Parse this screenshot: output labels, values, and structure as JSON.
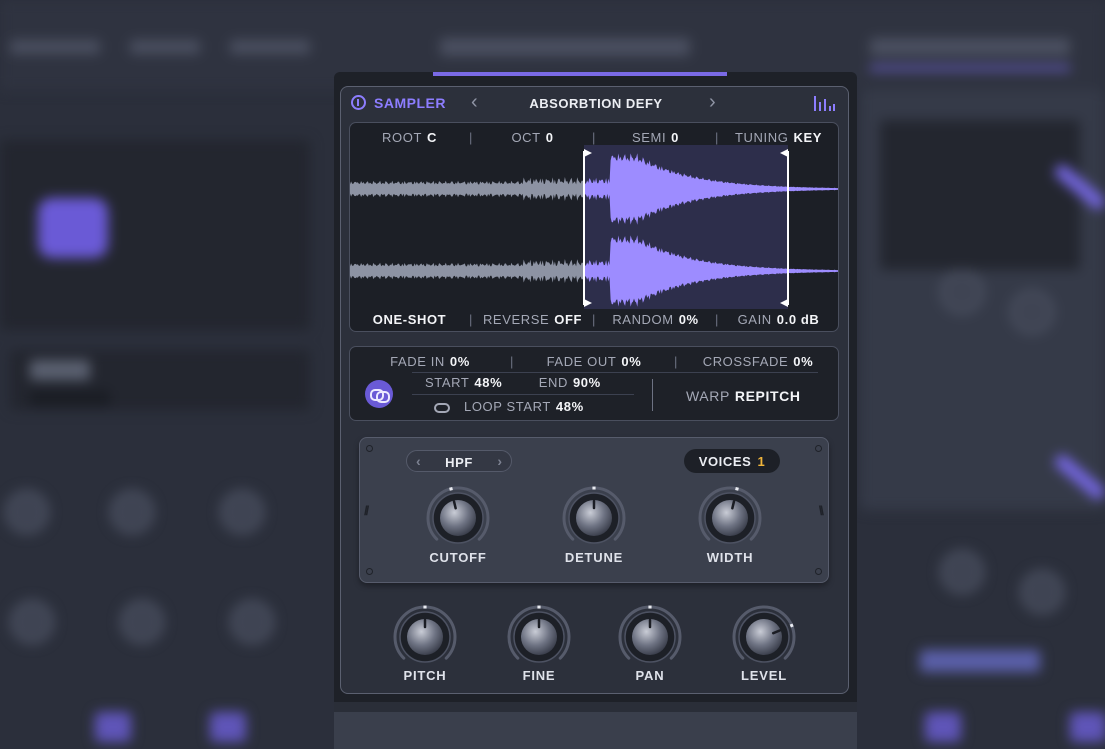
{
  "plugin": {
    "title": "SAMPLER",
    "preset": "ABSORBTION DEFY",
    "prev_arrow": "‹",
    "next_arrow": "›",
    "accent_color": "#8d7dff"
  },
  "sample_top": {
    "root_label": "ROOT",
    "root_value": "C",
    "oct_label": "OCT",
    "oct_value": "0",
    "semi_label": "SEMI",
    "semi_value": "0",
    "tuning_label": "TUNING",
    "tuning_value": "KEY"
  },
  "sample_bottom": {
    "mode_value": "ONE-SHOT",
    "reverse_label": "REVERSE",
    "reverse_value": "OFF",
    "random_label": "RANDOM",
    "random_value": "0%",
    "gain_label": "GAIN",
    "gain_value": "0.0 dB"
  },
  "fade": {
    "fade_in_label": "FADE IN",
    "fade_in_value": "0%",
    "fade_out_label": "FADE OUT",
    "fade_out_value": "0%",
    "crossfade_label": "CROSSFADE",
    "crossfade_value": "0%",
    "start_label": "START",
    "start_value": "48%",
    "end_label": "END",
    "end_value": "90%",
    "loop_start_label": "LOOP START",
    "loop_start_value": "48%",
    "warp_label": "WARP",
    "warp_value": "REPITCH"
  },
  "filter": {
    "type": "HPF",
    "voices_label": "VOICES",
    "voices_value": "1",
    "knobs": [
      "CUTOFF",
      "DETUNE",
      "WIDTH"
    ]
  },
  "main_knobs": [
    "PITCH",
    "FINE",
    "PAN",
    "LEVEL"
  ],
  "knob_levels": {
    "cutoff": 0.45,
    "detune": 0.5,
    "width": 0.55,
    "pitch": 0.5,
    "fine": 0.5,
    "pan": 0.5,
    "level": 0.75
  },
  "sample_region": {
    "start_fraction": 0.48,
    "end_fraction": 0.9
  }
}
